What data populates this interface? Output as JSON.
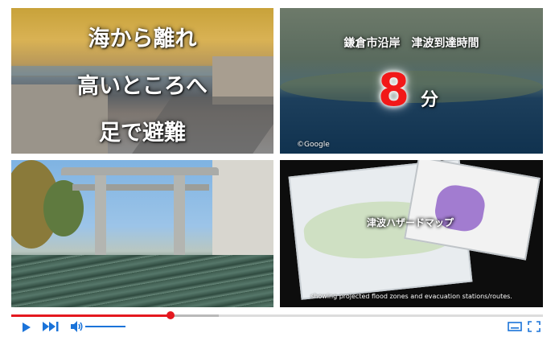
{
  "panels": {
    "top_left": {
      "lines": [
        "海から離れ",
        "高いところへ",
        "足で避難"
      ]
    },
    "top_right": {
      "heading": "鎌倉市沿岸　津波到達時間",
      "minutes_number": "8",
      "minutes_unit": "分",
      "map_credit": "©Google"
    },
    "bottom_left": {},
    "bottom_right": {
      "map_title": "津波ハザードマップ",
      "caption": "showing projected flood zones and evacuation stations/routes."
    }
  },
  "player": {
    "progress_fraction": 0.3,
    "buffered_fraction": 0.39,
    "volume_fraction": 1.0,
    "colors": {
      "accent": "#1a73d9",
      "progress": "#e4181f"
    },
    "icons": {
      "play": "play-icon",
      "next": "next-icon",
      "volume": "volume-icon",
      "captions": "captions-icon",
      "fullscreen": "fullscreen-icon"
    }
  }
}
